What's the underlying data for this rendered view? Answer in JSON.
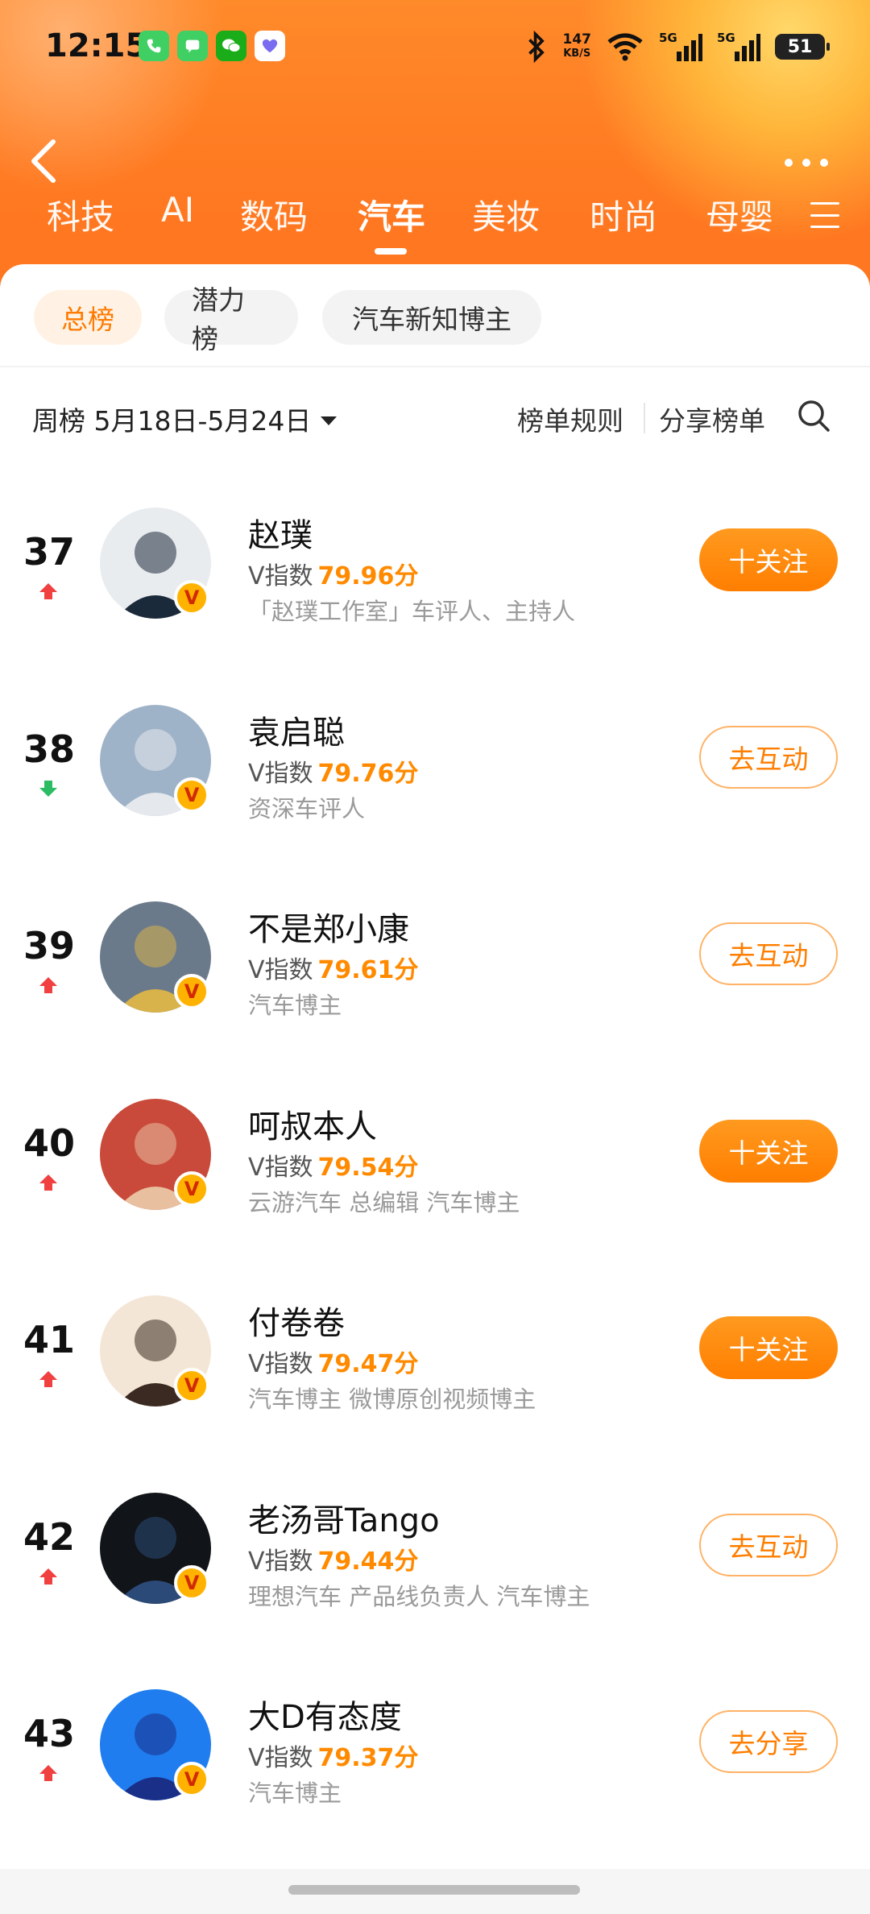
{
  "status_bar": {
    "time": "12:15",
    "app_icons": [
      {
        "icon": "phone-icon",
        "color": "#35c759"
      },
      {
        "icon": "messages-icon",
        "color": "#34c759"
      },
      {
        "icon": "wechat-icon",
        "color": "#1aad19"
      },
      {
        "icon": "health-icon",
        "color": "#ffffff"
      }
    ],
    "net_speed": "147",
    "net_unit": "KB/S",
    "signal_label_1": "5G",
    "signal_label_2": "5G",
    "battery": "51"
  },
  "tabs": [
    {
      "label": "科技",
      "active": false
    },
    {
      "label": "AI",
      "active": false
    },
    {
      "label": "数码",
      "active": false
    },
    {
      "label": "汽车",
      "active": true
    },
    {
      "label": "美妆",
      "active": false
    },
    {
      "label": "时尚",
      "active": false
    },
    {
      "label": "母婴",
      "active": false
    }
  ],
  "chips": [
    {
      "label": "总榜",
      "active": true
    },
    {
      "label": "潜力榜",
      "active": false
    },
    {
      "label": "汽车新知博主",
      "active": false
    }
  ],
  "period": "周榜 5月18日-5月24日",
  "rules_label": "榜单规则",
  "share_label": "分享榜单",
  "v_index_label": "V指数",
  "rows": [
    {
      "rank": "37",
      "trend": "up",
      "name": "赵璞",
      "score": "79.96分",
      "desc": "「赵璞工作室」车评人、主持人",
      "button": "十关注",
      "button_style": "primary",
      "avatar_colors": [
        "#e9ecef",
        "#1b2a3a"
      ]
    },
    {
      "rank": "38",
      "trend": "down",
      "name": "袁启聪",
      "score": "79.76分",
      "desc": "资深车评人",
      "button": "去互动",
      "button_style": "secondary",
      "avatar_colors": [
        "#9fb3c8",
        "#e5e8ec"
      ]
    },
    {
      "rank": "39",
      "trend": "up",
      "name": "不是郑小康",
      "score": "79.61分",
      "desc": "汽车博主",
      "button": "去互动",
      "button_style": "secondary",
      "avatar_colors": [
        "#6b7a8a",
        "#d8b24a"
      ]
    },
    {
      "rank": "40",
      "trend": "up",
      "name": "呵叔本人",
      "score": "79.54分",
      "desc": "云游汽车 总编辑 汽车博主",
      "button": "十关注",
      "button_style": "primary",
      "avatar_colors": [
        "#c94a3a",
        "#e8c0a0"
      ]
    },
    {
      "rank": "41",
      "trend": "up",
      "name": "付卷卷",
      "score": "79.47分",
      "desc": "汽车博主 微博原创视频博主",
      "button": "十关注",
      "button_style": "primary",
      "avatar_colors": [
        "#f3e6d6",
        "#3a2a22"
      ]
    },
    {
      "rank": "42",
      "trend": "up",
      "name": "老汤哥Tango",
      "score": "79.44分",
      "desc": "理想汽车 产品线负责人 汽车博主",
      "button": "去互动",
      "button_style": "secondary",
      "avatar_colors": [
        "#111418",
        "#2c4a78"
      ]
    },
    {
      "rank": "43",
      "trend": "up",
      "name": "大D有态度",
      "score": "79.37分",
      "desc": "汽车博主",
      "button": "去分享",
      "button_style": "secondary",
      "avatar_colors": [
        "#1f7df0",
        "#1a2f88"
      ]
    }
  ],
  "colors": {
    "accent": "#ff7e00",
    "up": "#f04040",
    "down": "#2dbb63"
  }
}
